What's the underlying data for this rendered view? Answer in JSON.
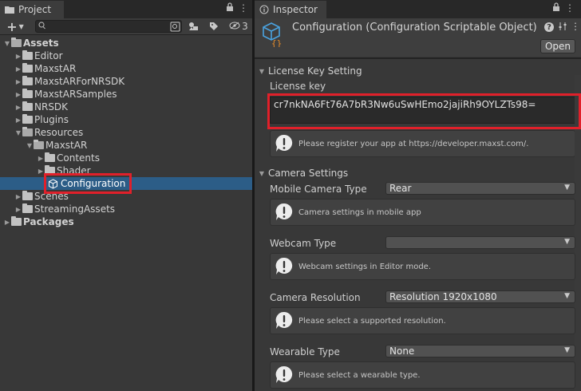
{
  "project": {
    "tab_label": "Project",
    "hidden_count": "3",
    "search": {
      "placeholder": "",
      "value": ""
    },
    "tree": [
      {
        "label": "Assets",
        "bold": true,
        "expanded": true
      },
      {
        "label": "Editor"
      },
      {
        "label": "MaxstAR"
      },
      {
        "label": "MaxstARForNRSDK"
      },
      {
        "label": "MaxstARSamples"
      },
      {
        "label": "NRSDK"
      },
      {
        "label": "Plugins"
      },
      {
        "label": "Resources",
        "expanded": true
      },
      {
        "label": "MaxstAR",
        "expanded": true
      },
      {
        "label": "Contents"
      },
      {
        "label": "Shader"
      },
      {
        "label": "Configuration",
        "selected": true
      },
      {
        "label": "Scenes"
      },
      {
        "label": "StreamingAssets"
      },
      {
        "label": "Packages",
        "bold": true
      }
    ]
  },
  "inspector": {
    "tab_label": "Inspector",
    "object_title": "Configuration (Configuration Scriptable Object)",
    "open_button": "Open",
    "license_section": "License Key Setting",
    "license_label": "License key",
    "license_value": "cr7nkNA6Ft76A7bR3Nw6uSwHEmo2jajiRh9OYLZTs98=",
    "license_help": "Please register your app at https://developer.maxst.com/.",
    "camera_section": "Camera Settings",
    "fields": [
      {
        "label": "Mobile Camera Type",
        "value": "Rear",
        "help": "Camera settings in mobile app"
      },
      {
        "label": "Webcam Type",
        "value": "",
        "help": "Webcam settings in Editor mode."
      },
      {
        "label": "Camera Resolution",
        "value": "Resolution 1920x1080",
        "help": "Please select a supported resolution."
      },
      {
        "label": "Wearable Type",
        "value": "None",
        "help": "Please select a wearable type."
      }
    ]
  },
  "colors": {
    "highlight": "#e0202a",
    "selection": "#2c5d87",
    "panel": "#383838"
  },
  "icons": [
    "folder-icon",
    "lock-icon",
    "menu-icon",
    "plus-icon",
    "search-icon",
    "scriptable-object-icon",
    "help-icon",
    "settings-icon",
    "info-icon"
  ]
}
